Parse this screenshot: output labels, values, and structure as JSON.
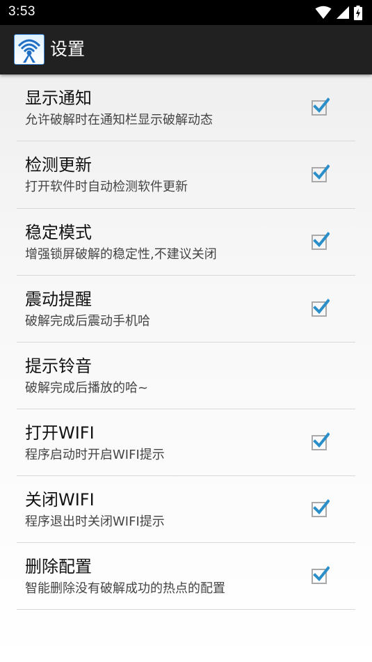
{
  "status_bar": {
    "time": "3:53",
    "icons": [
      "wifi-icon",
      "cellular-signal-icon",
      "battery-charging-icon"
    ]
  },
  "app_bar": {
    "icon": "app-logo-icon",
    "title": "设置"
  },
  "colors": {
    "accent": "#2a8fc8",
    "app_bar_bg": "#212121",
    "status_bar_bg": "#000000",
    "divider": "#d8d8d8"
  },
  "preferences": [
    {
      "title": "显示通知",
      "summary": "允许破解时在通知栏显示破解动态",
      "checked": true,
      "has_checkbox": true
    },
    {
      "title": "检测更新",
      "summary": "打开软件时自动检测软件更新",
      "checked": true,
      "has_checkbox": true
    },
    {
      "title": "稳定模式",
      "summary": "增强锁屏破解的稳定性,不建议关闭",
      "checked": true,
      "has_checkbox": true
    },
    {
      "title": "震动提醒",
      "summary": "破解完成后震动手机哈",
      "checked": true,
      "has_checkbox": true
    },
    {
      "title": "提示铃音",
      "summary": "破解完成后播放的哈~",
      "checked": false,
      "has_checkbox": false
    },
    {
      "title": "打开WIFI",
      "summary": "程序启动时开启WIFI提示",
      "checked": true,
      "has_checkbox": true
    },
    {
      "title": "关闭WIFI",
      "summary": "程序退出时关闭WIFI提示",
      "checked": true,
      "has_checkbox": true
    },
    {
      "title": "删除配置",
      "summary": "智能删除没有破解成功的热点的配置",
      "checked": true,
      "has_checkbox": true
    }
  ]
}
